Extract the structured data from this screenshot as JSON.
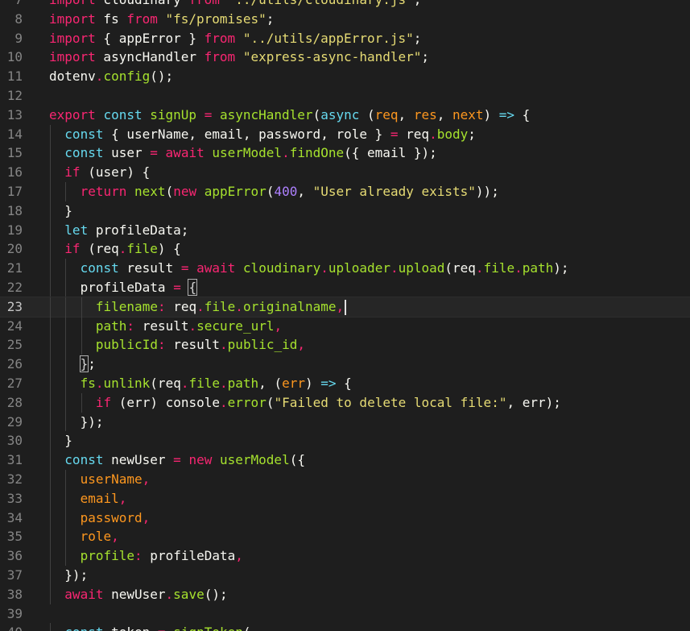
{
  "editor": {
    "language": "javascript",
    "current_line": 23,
    "colors": {
      "background": "#1e1e1e",
      "keyword": "#f92672",
      "storage": "#66d9ef",
      "function": "#a6e22e",
      "string": "#e6db74",
      "parameter": "#fd971f",
      "number": "#ae81ff",
      "line_number": "#858585"
    },
    "lines": [
      {
        "n": "7",
        "indent": 0,
        "tokens": [
          [
            "k",
            "import"
          ],
          [
            "t",
            " cloudinary "
          ],
          [
            "k",
            "from"
          ],
          [
            "s",
            " \"../utils/cloudinary.js\""
          ],
          [
            "t",
            ";"
          ]
        ]
      },
      {
        "n": "8",
        "indent": 0,
        "tokens": [
          [
            "k",
            "import"
          ],
          [
            "t",
            " fs "
          ],
          [
            "k",
            "from"
          ],
          [
            "s",
            " \"fs/promises\""
          ],
          [
            "t",
            ";"
          ]
        ]
      },
      {
        "n": "9",
        "indent": 0,
        "tokens": [
          [
            "k",
            "import"
          ],
          [
            "t",
            " { appError } "
          ],
          [
            "k",
            "from"
          ],
          [
            "s",
            " \"../utils/appError.js\""
          ],
          [
            "t",
            ";"
          ]
        ]
      },
      {
        "n": "10",
        "indent": 0,
        "tokens": [
          [
            "k",
            "import"
          ],
          [
            "t",
            " asyncHandler "
          ],
          [
            "k",
            "from"
          ],
          [
            "s",
            " \"express-async-handler\""
          ],
          [
            "t",
            ";"
          ]
        ]
      },
      {
        "n": "11",
        "indent": 0,
        "tokens": [
          [
            "t",
            "dotenv"
          ],
          [
            "o",
            "."
          ],
          [
            "f",
            "config"
          ],
          [
            "t",
            "();"
          ]
        ]
      },
      {
        "n": "12",
        "indent": 0,
        "tokens": []
      },
      {
        "n": "13",
        "indent": 0,
        "tokens": [
          [
            "k",
            "export"
          ],
          [
            "t",
            " "
          ],
          [
            "kb",
            "const"
          ],
          [
            "t",
            " "
          ],
          [
            "f",
            "signUp"
          ],
          [
            "t",
            " "
          ],
          [
            "o",
            "="
          ],
          [
            "t",
            " "
          ],
          [
            "f",
            "asyncHandler"
          ],
          [
            "t",
            "("
          ],
          [
            "kb",
            "async"
          ],
          [
            "t",
            " ("
          ],
          [
            "p",
            "req"
          ],
          [
            "t",
            ", "
          ],
          [
            "p",
            "res"
          ],
          [
            "t",
            ", "
          ],
          [
            "p",
            "next"
          ],
          [
            "t",
            ") "
          ],
          [
            "kb",
            "=>"
          ],
          [
            "t",
            " {"
          ]
        ]
      },
      {
        "n": "14",
        "indent": 1,
        "tokens": [
          [
            "kb",
            "const"
          ],
          [
            "t",
            " { userName, email, password, role } "
          ],
          [
            "o",
            "="
          ],
          [
            "t",
            " req"
          ],
          [
            "o",
            "."
          ],
          [
            "pr",
            "body"
          ],
          [
            "t",
            ";"
          ]
        ]
      },
      {
        "n": "15",
        "indent": 1,
        "tokens": [
          [
            "kb",
            "const"
          ],
          [
            "t",
            " user "
          ],
          [
            "o",
            "="
          ],
          [
            "t",
            " "
          ],
          [
            "k",
            "await"
          ],
          [
            "t",
            " "
          ],
          [
            "f",
            "userModel"
          ],
          [
            "o",
            "."
          ],
          [
            "f",
            "findOne"
          ],
          [
            "t",
            "({ email });"
          ]
        ]
      },
      {
        "n": "16",
        "indent": 1,
        "tokens": [
          [
            "k",
            "if"
          ],
          [
            "t",
            " (user) {"
          ]
        ]
      },
      {
        "n": "17",
        "indent": 2,
        "tokens": [
          [
            "k",
            "return"
          ],
          [
            "t",
            " "
          ],
          [
            "f",
            "next"
          ],
          [
            "t",
            "("
          ],
          [
            "k",
            "new"
          ],
          [
            "t",
            " "
          ],
          [
            "f",
            "appError"
          ],
          [
            "t",
            "("
          ],
          [
            "n",
            "400"
          ],
          [
            "t",
            ", "
          ],
          [
            "s",
            "\"User already exists\""
          ],
          [
            "t",
            "));"
          ]
        ]
      },
      {
        "n": "18",
        "indent": 1,
        "tokens": [
          [
            "t",
            "}"
          ]
        ]
      },
      {
        "n": "19",
        "indent": 1,
        "tokens": [
          [
            "kb",
            "let"
          ],
          [
            "t",
            " profileData;"
          ]
        ]
      },
      {
        "n": "20",
        "indent": 1,
        "tokens": [
          [
            "k",
            "if"
          ],
          [
            "t",
            " (req"
          ],
          [
            "o",
            "."
          ],
          [
            "pr",
            "file"
          ],
          [
            "t",
            ") {"
          ]
        ]
      },
      {
        "n": "21",
        "indent": 2,
        "tokens": [
          [
            "kb",
            "const"
          ],
          [
            "t",
            " result "
          ],
          [
            "o",
            "="
          ],
          [
            "t",
            " "
          ],
          [
            "k",
            "await"
          ],
          [
            "t",
            " "
          ],
          [
            "f",
            "cloudinary"
          ],
          [
            "o",
            "."
          ],
          [
            "pr",
            "uploader"
          ],
          [
            "o",
            "."
          ],
          [
            "f",
            "upload"
          ],
          [
            "t",
            "(req"
          ],
          [
            "o",
            "."
          ],
          [
            "pr",
            "file"
          ],
          [
            "o",
            "."
          ],
          [
            "pr",
            "path"
          ],
          [
            "t",
            ");"
          ]
        ]
      },
      {
        "n": "22",
        "indent": 2,
        "tokens": [
          [
            "t",
            "profileData "
          ],
          [
            "o",
            "="
          ],
          [
            "t",
            " "
          ],
          [
            "bm",
            "{"
          ]
        ]
      },
      {
        "n": "23",
        "indent": 3,
        "tokens": [
          [
            "f",
            "filename"
          ],
          [
            "o",
            ":"
          ],
          [
            "t",
            " req"
          ],
          [
            "o",
            "."
          ],
          [
            "pr",
            "file"
          ],
          [
            "o",
            "."
          ],
          [
            "pr",
            "originalname"
          ],
          [
            "o",
            ","
          ],
          [
            "cursor",
            ""
          ]
        ]
      },
      {
        "n": "24",
        "indent": 3,
        "tokens": [
          [
            "f",
            "path"
          ],
          [
            "o",
            ":"
          ],
          [
            "t",
            " result"
          ],
          [
            "o",
            "."
          ],
          [
            "pr",
            "secure_url"
          ],
          [
            "o",
            ","
          ]
        ]
      },
      {
        "n": "25",
        "indent": 3,
        "tokens": [
          [
            "f",
            "publicId"
          ],
          [
            "o",
            ":"
          ],
          [
            "t",
            " result"
          ],
          [
            "o",
            "."
          ],
          [
            "pr",
            "public_id"
          ],
          [
            "o",
            ","
          ]
        ]
      },
      {
        "n": "26",
        "indent": 2,
        "tokens": [
          [
            "bm",
            "}"
          ],
          [
            "t",
            ";"
          ]
        ]
      },
      {
        "n": "27",
        "indent": 2,
        "tokens": [
          [
            "f",
            "fs"
          ],
          [
            "o",
            "."
          ],
          [
            "f",
            "unlink"
          ],
          [
            "t",
            "(req"
          ],
          [
            "o",
            "."
          ],
          [
            "pr",
            "file"
          ],
          [
            "o",
            "."
          ],
          [
            "pr",
            "path"
          ],
          [
            "t",
            ", ("
          ],
          [
            "p",
            "err"
          ],
          [
            "t",
            ") "
          ],
          [
            "kb",
            "=>"
          ],
          [
            "t",
            " {"
          ]
        ]
      },
      {
        "n": "28",
        "indent": 3,
        "tokens": [
          [
            "k",
            "if"
          ],
          [
            "t",
            " (err) console"
          ],
          [
            "o",
            "."
          ],
          [
            "f",
            "error"
          ],
          [
            "t",
            "("
          ],
          [
            "s",
            "\"Failed to delete local file:\""
          ],
          [
            "t",
            ", err);"
          ]
        ]
      },
      {
        "n": "29",
        "indent": 2,
        "tokens": [
          [
            "t",
            "});"
          ]
        ]
      },
      {
        "n": "30",
        "indent": 1,
        "tokens": [
          [
            "t",
            "}"
          ]
        ]
      },
      {
        "n": "31",
        "indent": 1,
        "tokens": [
          [
            "kb",
            "const"
          ],
          [
            "t",
            " newUser "
          ],
          [
            "o",
            "="
          ],
          [
            "t",
            " "
          ],
          [
            "k",
            "new"
          ],
          [
            "t",
            " "
          ],
          [
            "f",
            "userModel"
          ],
          [
            "t",
            "({"
          ]
        ]
      },
      {
        "n": "32",
        "indent": 2,
        "tokens": [
          [
            "p",
            "userName"
          ],
          [
            "o",
            ","
          ]
        ]
      },
      {
        "n": "33",
        "indent": 2,
        "tokens": [
          [
            "p",
            "email"
          ],
          [
            "o",
            ","
          ]
        ]
      },
      {
        "n": "34",
        "indent": 2,
        "tokens": [
          [
            "p",
            "password"
          ],
          [
            "o",
            ","
          ]
        ]
      },
      {
        "n": "35",
        "indent": 2,
        "tokens": [
          [
            "p",
            "role"
          ],
          [
            "o",
            ","
          ]
        ]
      },
      {
        "n": "36",
        "indent": 2,
        "tokens": [
          [
            "f",
            "profile"
          ],
          [
            "o",
            ":"
          ],
          [
            "t",
            " profileData"
          ],
          [
            "o",
            ","
          ]
        ]
      },
      {
        "n": "37",
        "indent": 1,
        "tokens": [
          [
            "t",
            "});"
          ]
        ]
      },
      {
        "n": "38",
        "indent": 1,
        "tokens": [
          [
            "k",
            "await"
          ],
          [
            "t",
            " newUser"
          ],
          [
            "o",
            "."
          ],
          [
            "f",
            "save"
          ],
          [
            "t",
            "();"
          ]
        ]
      },
      {
        "n": "39",
        "indent": 0,
        "tokens": []
      },
      {
        "n": "40",
        "indent": 1,
        "tokens": [
          [
            "kb",
            "const"
          ],
          [
            "t",
            " token "
          ],
          [
            "o",
            "="
          ],
          [
            "t",
            " "
          ],
          [
            "f",
            "signToken"
          ],
          [
            "t",
            "("
          ]
        ]
      }
    ]
  }
}
